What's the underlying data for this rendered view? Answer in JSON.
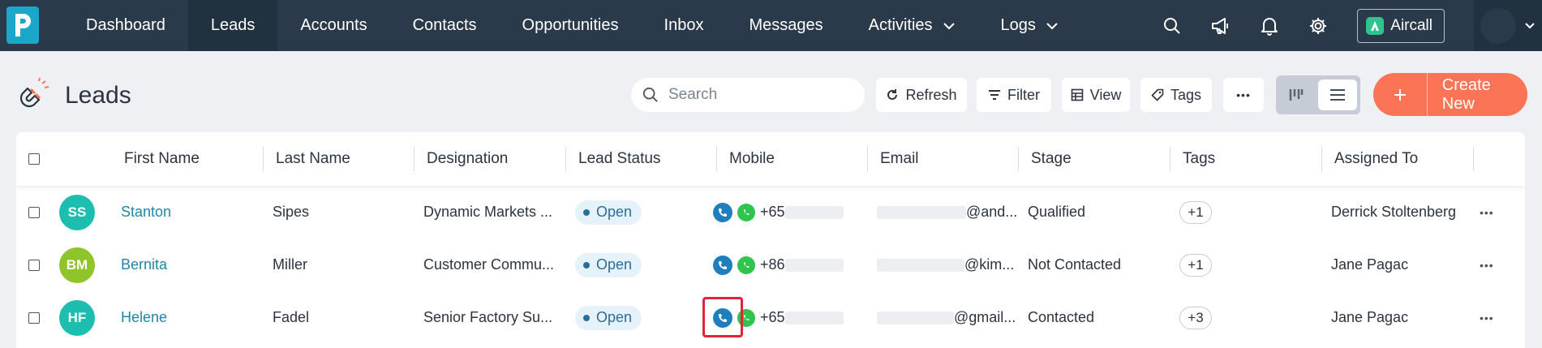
{
  "topnav": {
    "items": [
      {
        "label": "Dashboard"
      },
      {
        "label": "Leads",
        "active": true
      },
      {
        "label": "Accounts"
      },
      {
        "label": "Contacts"
      },
      {
        "label": "Opportunities"
      },
      {
        "label": "Inbox"
      },
      {
        "label": "Messages"
      },
      {
        "label": "Activities",
        "dropdown": true
      },
      {
        "label": "Logs",
        "dropdown": true
      }
    ],
    "aircall_label": "Aircall",
    "icons": [
      "search-icon",
      "megaphone-icon",
      "bell-icon",
      "gear-icon",
      "chevron-down-icon"
    ]
  },
  "page": {
    "title": "Leads",
    "search_placeholder": "Search",
    "buttons": {
      "refresh": "Refresh",
      "filter": "Filter",
      "view": "View",
      "tags": "Tags",
      "more": "•••",
      "create_new": "Create New"
    }
  },
  "table": {
    "headers": {
      "first_name": "First Name",
      "last_name": "Last Name",
      "designation": "Designation",
      "lead_status": "Lead Status",
      "mobile": "Mobile",
      "email": "Email",
      "stage": "Stage",
      "tags": "Tags",
      "assigned_to": "Assigned To"
    },
    "rows": [
      {
        "initials": "SS",
        "avatar_color": "#1dbdb0",
        "first_name": "Stanton",
        "last_name": "Sipes",
        "designation": "Dynamic Markets ...",
        "status": "Open",
        "mobile": "+65",
        "email": "@and...",
        "stage": "Qualified",
        "tags": "+1",
        "assigned_to": "Derrick Stoltenberg",
        "more": "•••"
      },
      {
        "initials": "BM",
        "avatar_color": "#8fc42a",
        "first_name": "Bernita",
        "last_name": "Miller",
        "designation": "Customer Commu...",
        "status": "Open",
        "mobile": "+86",
        "email": "@kim...",
        "stage": "Not Contacted",
        "tags": "+1",
        "assigned_to": "Jane Pagac",
        "more": "•••"
      },
      {
        "initials": "HF",
        "avatar_color": "#1dbdb0",
        "first_name": "Helene",
        "last_name": "Fadel",
        "designation": "Senior Factory Su...",
        "status": "Open",
        "mobile": "+65",
        "email": "@gmail...",
        "stage": "Contacted",
        "tags": "+3",
        "assigned_to": "Jane Pagac",
        "more": "•••"
      }
    ]
  },
  "colors": {
    "nav_bg": "#2b3a4a",
    "accent": "#fb7455",
    "link": "#1e86a6",
    "highlight": "#e0243c"
  }
}
